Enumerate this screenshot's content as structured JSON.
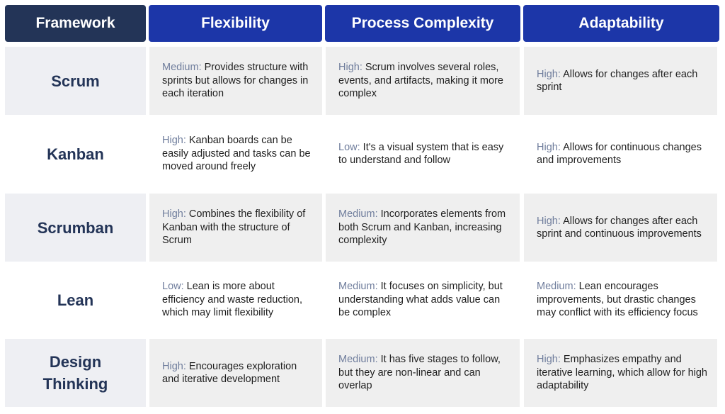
{
  "table": {
    "headers": [
      "Framework",
      "Flexibility",
      "Process Complexity",
      "Adaptability"
    ],
    "rows": [
      {
        "framework": "Scrum",
        "flexibility": {
          "level": "Medium:",
          "text": " Provides structure with sprints but allows for changes in each iteration"
        },
        "complexity": {
          "level": "High:",
          "text": " Scrum involves several roles, events, and artifacts, making it more complex"
        },
        "adaptability": {
          "level": "High:",
          "text": " Allows for changes after each sprint"
        }
      },
      {
        "framework": "Kanban",
        "flexibility": {
          "level": "High:",
          "text": " Kanban boards can be easily adjusted and tasks can be moved around freely"
        },
        "complexity": {
          "level": "Low:",
          "text": " It's a visual system that is easy to understand and follow"
        },
        "adaptability": {
          "level": "High:",
          "text": " Allows for continuous changes and improvements"
        }
      },
      {
        "framework": "Scrumban",
        "flexibility": {
          "level": "High:",
          "text": " Combines the flexibility of Kanban with the structure of Scrum"
        },
        "complexity": {
          "level": "Medium:",
          "text": " Incorporates elements from both Scrum and Kanban, increasing complexity"
        },
        "adaptability": {
          "level": "High:",
          "text": " Allows for changes after each sprint and continuous improvements"
        }
      },
      {
        "framework": "Lean",
        "flexibility": {
          "level": "Low:",
          "text": " Lean is more about efficiency and waste reduction, which may limit flexibility"
        },
        "complexity": {
          "level": "Medium:",
          "text": " It focuses on simplicity, but understanding what adds value can be complex"
        },
        "adaptability": {
          "level": "Medium:",
          "text": " Lean encourages improvements, but drastic changes may conflict with its efficiency focus"
        }
      },
      {
        "framework": "Design Thinking",
        "flexibility": {
          "level": "High:",
          "text": " Encourages exploration and iterative development"
        },
        "complexity": {
          "level": "Medium:",
          "text": " It has five stages to follow, but they are non-linear and can overlap"
        },
        "adaptability": {
          "level": "High:",
          "text": " Emphasizes empathy and iterative learning, which allow for high adaptability"
        }
      }
    ]
  },
  "colors": {
    "framework_header": "#233457",
    "column_header": "#1c36a8",
    "level_label": "#6f7d9c",
    "framework_text": "#233457",
    "alt_row": "#efefef"
  }
}
